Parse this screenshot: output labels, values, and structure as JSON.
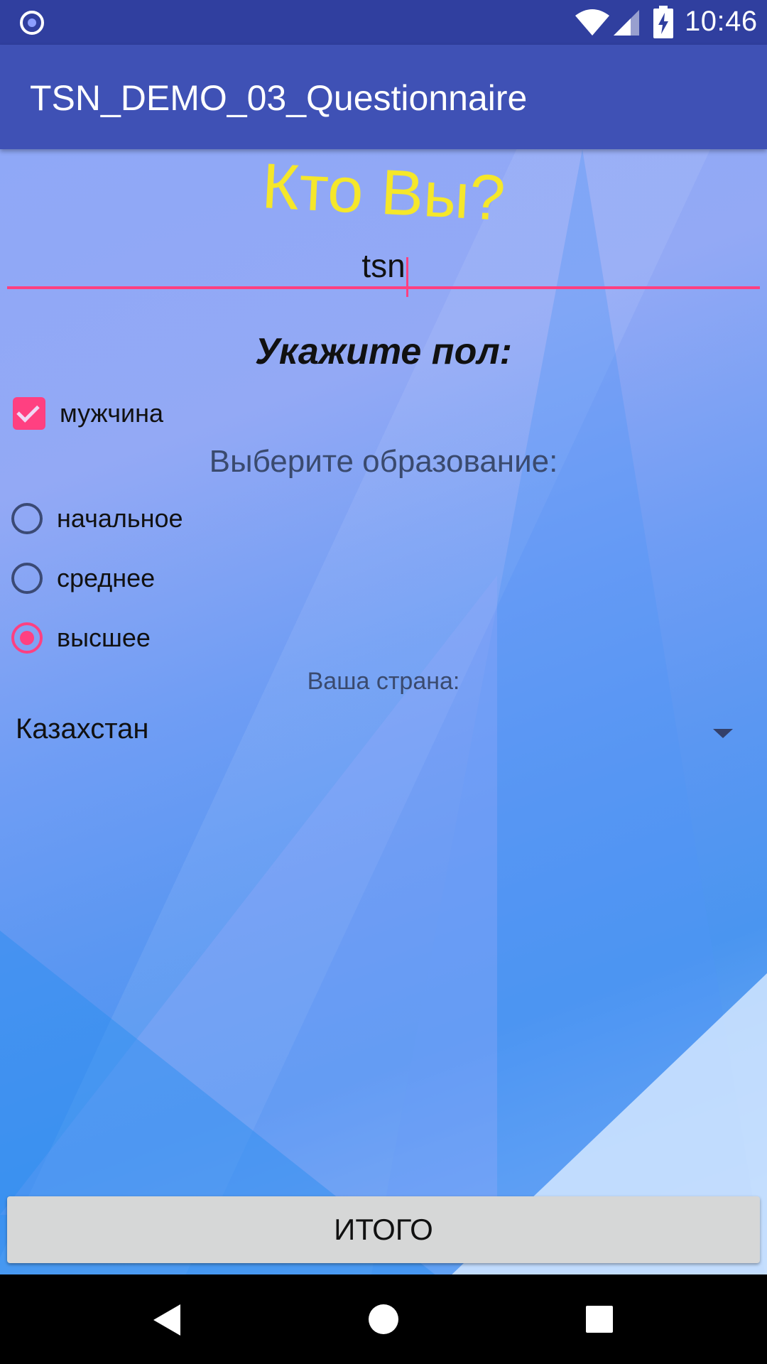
{
  "status_bar": {
    "time": "10:46",
    "icons": [
      "record-icon",
      "wifi-icon",
      "signal-icon",
      "battery-charging-icon"
    ]
  },
  "app_bar": {
    "title": "TSN_DEMO_03_Questionnaire"
  },
  "form": {
    "heading": "Кто Вы?",
    "name_input_value": "tsn",
    "gender_label": "Укажите пол:",
    "gender_checkbox": {
      "label": "мужчина",
      "checked": true
    },
    "education_label": "Выберите образование:",
    "education_options": [
      {
        "label": "начальное",
        "selected": false
      },
      {
        "label": "среднее",
        "selected": false
      },
      {
        "label": "высшее",
        "selected": true
      }
    ],
    "country_label": "Ваша страна:",
    "country_selected": "Казахстан",
    "submit_label": "ИТОГО"
  },
  "colors": {
    "status_bar": "#303f9f",
    "app_bar": "#3f51b5",
    "accent": "#ff4081",
    "heading": "#f5e72a"
  },
  "nav_bar": {
    "icons": [
      "back-icon",
      "home-icon",
      "recents-icon"
    ]
  }
}
